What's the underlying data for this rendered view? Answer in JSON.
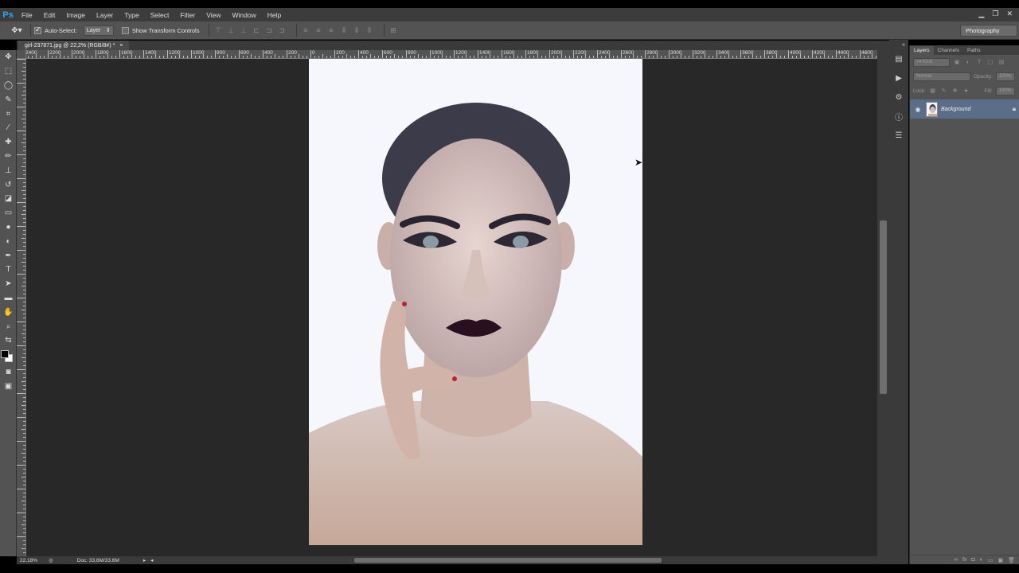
{
  "app": {
    "logo": "Ps",
    "window_controls": [
      "▁",
      "❐",
      "✕"
    ]
  },
  "menu": [
    "File",
    "Edit",
    "Image",
    "Layer",
    "Type",
    "Select",
    "Filter",
    "View",
    "Window",
    "Help"
  ],
  "options_bar": {
    "auto_select_label": "Auto-Select:",
    "auto_select_value": "Layer",
    "show_transform_label": "Show Transform Controls",
    "workspace": "Photography"
  },
  "document": {
    "tab_title": "girl-237871.jpg @ 22,2% (RGB/8#) *",
    "tab_close": "×"
  },
  "ruler": {
    "h_labels": [
      "2400",
      "2200",
      "2000",
      "1800",
      "1600",
      "1400",
      "1200",
      "1000",
      "800",
      "600",
      "400",
      "200",
      "0",
      "200",
      "400",
      "600",
      "800",
      "1000",
      "1200",
      "1400",
      "1600",
      "1800",
      "2000",
      "2200",
      "2400",
      "2600",
      "2800",
      "3000",
      "3200",
      "3400",
      "3600",
      "3800",
      "4000",
      "4200",
      "4400",
      "4600"
    ]
  },
  "statusbar": {
    "zoom": "22,18%",
    "doc": "Doc: 33,6M/33,6M"
  },
  "layers_panel": {
    "tabs": [
      "Layers",
      "Channels",
      "Paths"
    ],
    "kind_label": "Kind",
    "blend_mode": "Normal",
    "opacity_label": "Opacity:",
    "opacity_value": "100%",
    "lock_label": "Lock:",
    "fill_label": "Fill:",
    "fill_value": "100%",
    "layers": [
      {
        "name": "Background"
      }
    ]
  }
}
